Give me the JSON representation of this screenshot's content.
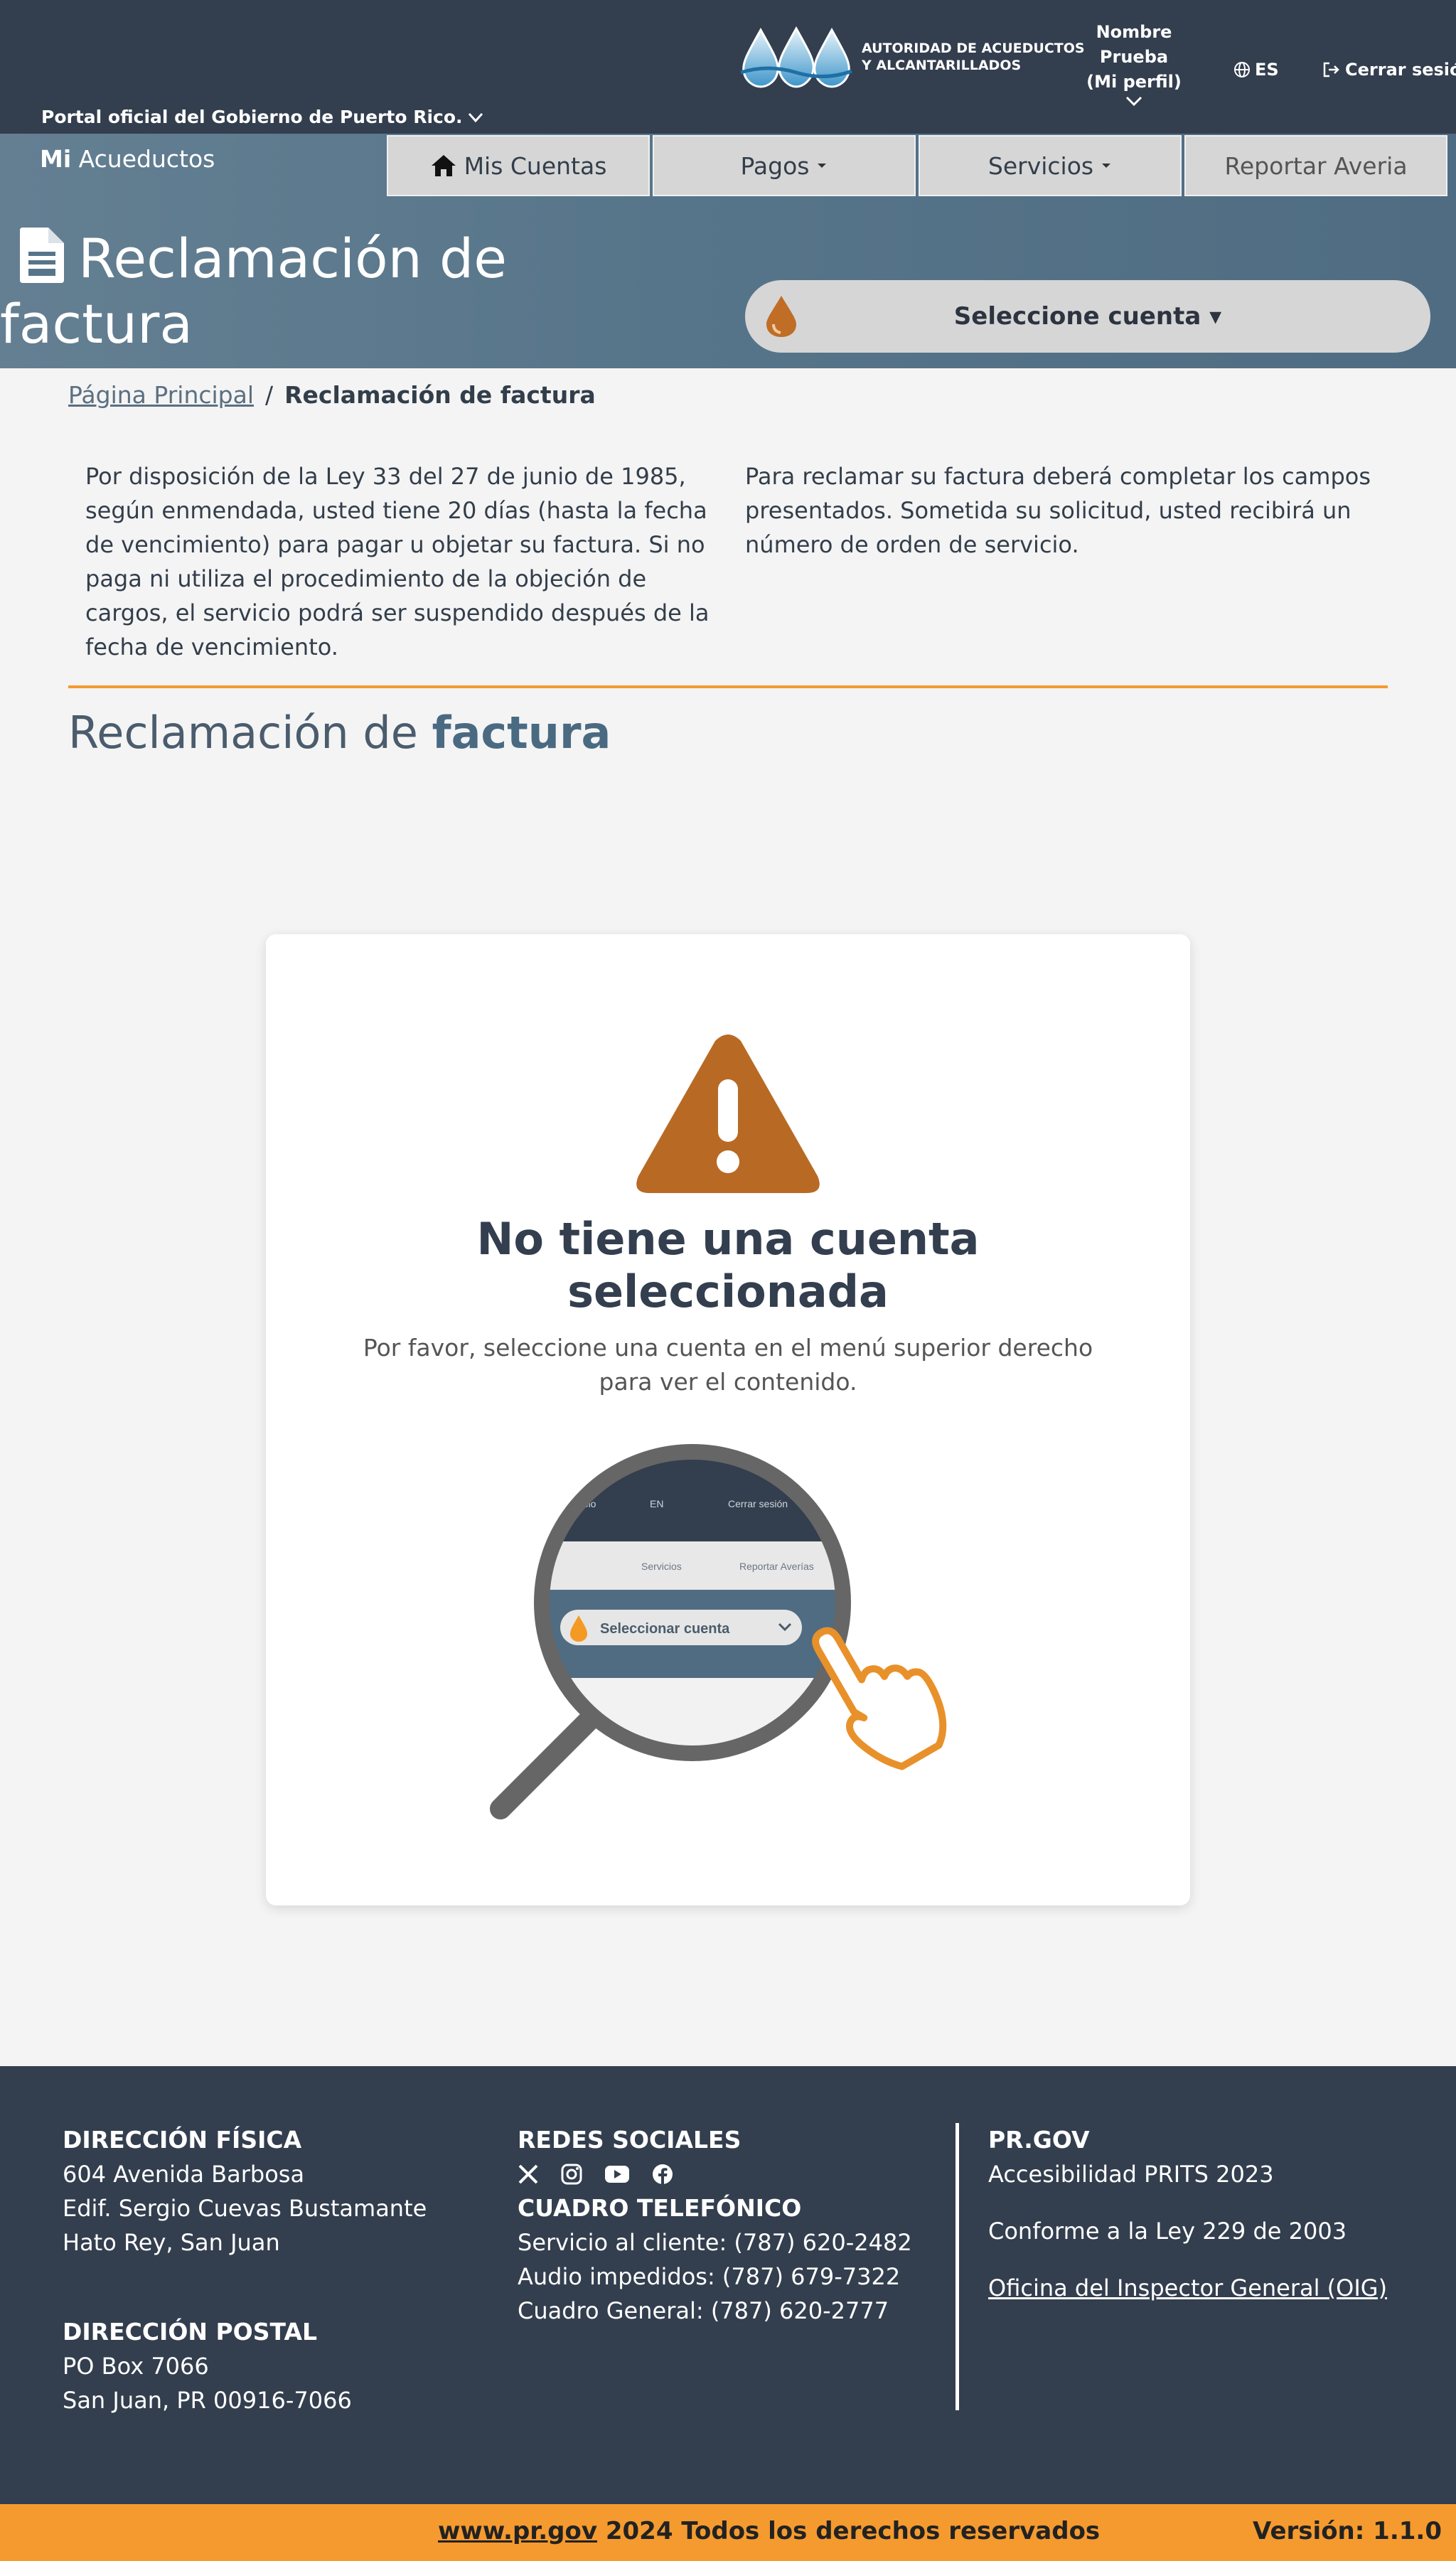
{
  "colors": {
    "header_dark": "#333e4e",
    "band_blue": "#57758a",
    "accent_orange": "#f59a2f",
    "warning_brown": "#b86a24",
    "nav_gray": "#d6d6d6"
  },
  "header": {
    "portal_link": "Portal oficial del Gobierno de Puerto Rico.",
    "brand_line1": "AUTORIDAD DE ACUEDUCTOS",
    "brand_line2": "Y ALCANTARILLADOS",
    "profile_line1": "Nombre",
    "profile_line2": "Prueba",
    "profile_line3": "(Mi perfil)",
    "language": "ES",
    "logout": "Cerrar sesión"
  },
  "band": {
    "app_title_bold": "Mi",
    "app_title_rest": "Acueductos",
    "nav": {
      "accounts": "Mis Cuentas",
      "payments": "Pagos",
      "services": "Servicios",
      "report": "Reportar Averia"
    },
    "page_title_line1": "Reclamación de",
    "page_title_line2": "factura",
    "account_select": "Seleccione cuenta ▾"
  },
  "breadcrumb": {
    "home": "Página Principal",
    "separator": "/",
    "current": "Reclamación de factura"
  },
  "intro": {
    "left": "Por disposición de la Ley 33 del 27 de junio de 1985, según enmendada, usted tiene 20 días (hasta la fecha de vencimiento) para pagar u objetar su factura. Si no paga ni utiliza el procedimiento de la objeción de cargos, el servicio podrá ser suspendido después de la fecha de vencimiento.",
    "right": "Para reclamar su factura deberá completar los campos presentados. Sometida su solicitud, usted recibirá un número de orden de servicio."
  },
  "section": {
    "title_plain": "Reclamación de",
    "title_bold": "factura"
  },
  "card": {
    "heading_line1": "No tiene una cuenta",
    "heading_line2": "seleccionada",
    "text": "Por favor, seleccione una cuenta en el menú superior derecho para ver el contenido.",
    "illustration": {
      "top_text1": "ablo",
      "top_text2": "EN",
      "top_text3": "Cerrar sesión",
      "menu_text1": "Servicios",
      "menu_text2": "Reportar Averías",
      "select_label": "Seleccionar cuenta"
    }
  },
  "footer": {
    "physical_title": "DIRECCIÓN FÍSICA",
    "physical_line1": "604 Avenida Barbosa",
    "physical_line2": "Edif. Sergio Cuevas Bustamante",
    "physical_line3": "Hato Rey, San Juan",
    "postal_title": "DIRECCIÓN POSTAL",
    "postal_line1": "PO Box 7066",
    "postal_line2": "San Juan, PR 00916-7066",
    "social_title": "REDES SOCIALES",
    "phone_title": "CUADRO TELEFÓNICO",
    "phone_line1": "Servicio al cliente: (787) 620-2482",
    "phone_line2": "Audio impedidos: (787) 679-7322",
    "phone_line3": "Cuadro General: (787) 620-2777",
    "prgov_title": "PR.GOV",
    "prgov_line1": "Accesibilidad PRITS 2023",
    "prgov_line2": "Conforme a la Ley 229 de 2003",
    "prgov_link": "Oficina del Inspector General (OIG)"
  },
  "bottom_bar": {
    "site_link": "www.pr.gov",
    "copyright": " 2024 Todos los derechos reservados",
    "version": "Versión: 1.1.0"
  }
}
